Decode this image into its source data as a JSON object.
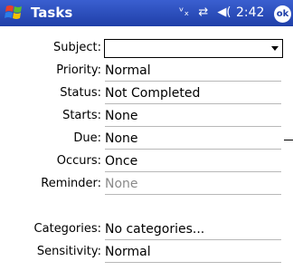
{
  "titlebar": {
    "title": "Tasks",
    "status_icons": [
      "signal-icon",
      "connectivity-icon",
      "volume-icon"
    ],
    "time": "2:42",
    "ok_label": "ok"
  },
  "fields": {
    "subject": {
      "label": "Subject:",
      "value": ""
    },
    "priority": {
      "label": "Priority:",
      "value": "Normal"
    },
    "status": {
      "label": "Status:",
      "value": "Not Completed"
    },
    "starts": {
      "label": "Starts:",
      "value": "None"
    },
    "due": {
      "label": "Due:",
      "value": "None"
    },
    "occurs": {
      "label": "Occurs:",
      "value": "Once"
    },
    "reminder": {
      "label": "Reminder:",
      "value": "None"
    },
    "categories": {
      "label": "Categories:",
      "value": "No categories..."
    },
    "sensitivity": {
      "label": "Sensitivity:",
      "value": "Normal"
    }
  }
}
